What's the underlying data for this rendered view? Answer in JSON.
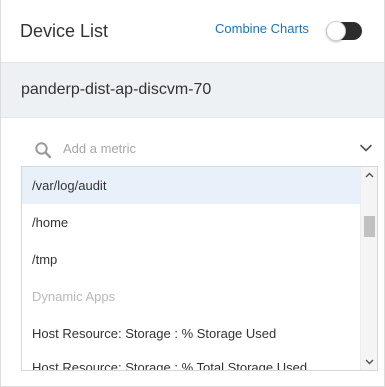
{
  "header": {
    "title": "Device List",
    "combine_label": "Combine Charts",
    "combine_enabled": false
  },
  "device": {
    "name": "panderp-dist-ap-discvm-70"
  },
  "metric": {
    "placeholder": "Add a metric",
    "value": "",
    "icons": {
      "search": "search-icon",
      "dropdown": "chevron-down-icon"
    }
  },
  "list": {
    "items": [
      {
        "label": "/var/log/audit",
        "type": "option",
        "selected": true
      },
      {
        "label": "/home",
        "type": "option",
        "selected": false
      },
      {
        "label": "/tmp",
        "type": "option",
        "selected": false
      },
      {
        "label": "Dynamic Apps",
        "type": "group",
        "selected": false
      },
      {
        "label": "Host Resource: Storage : % Storage Used",
        "type": "option",
        "selected": false
      },
      {
        "label": "Host Resource: Storage : % Total Storage Used",
        "type": "option",
        "selected": false
      }
    ]
  },
  "colors": {
    "accent": "#1a73c6",
    "selected_bg": "#e8f1fa",
    "device_bar_bg": "#eef1f4",
    "group_text": "#b9b9b9",
    "toggle_track": "#2d2d2d"
  }
}
